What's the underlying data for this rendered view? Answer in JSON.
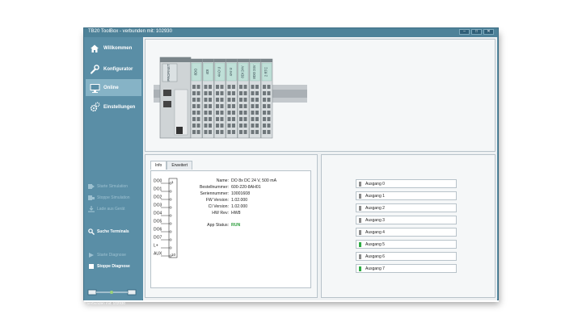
{
  "window": {
    "title": "TB20 ToolBox - verbunden mit: 102930",
    "controls": [
      "–",
      "□",
      "✕"
    ]
  },
  "sidebar": {
    "nav": [
      {
        "label": "Willkommen",
        "icon": "home-icon",
        "active": false
      },
      {
        "label": "Konfigurator",
        "icon": "wrench-icon",
        "active": false
      },
      {
        "label": "Online",
        "icon": "monitor-icon",
        "active": true
      },
      {
        "label": "Einstellungen",
        "icon": "gears-icon",
        "active": false
      }
    ],
    "actions": [
      {
        "label": "Starte Simulation",
        "icon": "play-sim-icon",
        "enabled": false
      },
      {
        "label": "Stoppe Simulation",
        "icon": "stop-sim-icon",
        "enabled": false
      },
      {
        "label": "Lade aus Gerät",
        "icon": "download-icon",
        "enabled": false
      },
      {
        "label": "Suche Terminals",
        "icon": "search-icon",
        "enabled": true
      },
      {
        "label": "Starte Diagnose",
        "icon": "play-icon",
        "enabled": false
      },
      {
        "label": "Stoppe Diagnose",
        "icon": "stop-icon",
        "enabled": true
      }
    ],
    "status_text": "verbunden mit: 102930"
  },
  "device": {
    "modules": [
      "PROFINET",
      "8DO",
      "4DI",
      "4AO U",
      "4AI U",
      "8DI 24V",
      "8DO 24V",
      "2 RTC"
    ]
  },
  "info_panel": {
    "tabs": [
      "Info",
      "Erweitert"
    ],
    "selected_tab": "Info",
    "pin_labels": [
      "DO0",
      "DO1",
      "DO2",
      "DO3",
      "DO4",
      "DO5",
      "DO6",
      "DO7",
      "L+",
      "AUX"
    ],
    "pin_numbers": [
      "1",
      "10"
    ],
    "fields": [
      {
        "key": "Name:",
        "value": "DO 8x DC 24 V, 500 mA"
      },
      {
        "key": "Bestellnummer:",
        "value": "600-220-8AH01"
      },
      {
        "key": "Seriennummer:",
        "value": "10001608"
      },
      {
        "key": "FW Version:",
        "value": "1.02.000"
      },
      {
        "key": "CI Version:",
        "value": "1.02.000"
      },
      {
        "key": "HW Rev:",
        "value": "HW8"
      }
    ],
    "app_status_label": "App Status:",
    "app_status_value": "RUN"
  },
  "outputs": [
    {
      "label": "Ausgang 0",
      "state": "off"
    },
    {
      "label": "Ausgang 1",
      "state": "off"
    },
    {
      "label": "Ausgang 2",
      "state": "off"
    },
    {
      "label": "Ausgang 3",
      "state": "off"
    },
    {
      "label": "Ausgang 4",
      "state": "off"
    },
    {
      "label": "Ausgang 5",
      "state": "on"
    },
    {
      "label": "Ausgang 6",
      "state": "off"
    },
    {
      "label": "Ausgang 7",
      "state": "on"
    }
  ],
  "colors": {
    "led_on": "#2eab43",
    "led_off": "#8a8a8a",
    "accent": "#5a8ea6",
    "run": "#2a9c3a"
  }
}
